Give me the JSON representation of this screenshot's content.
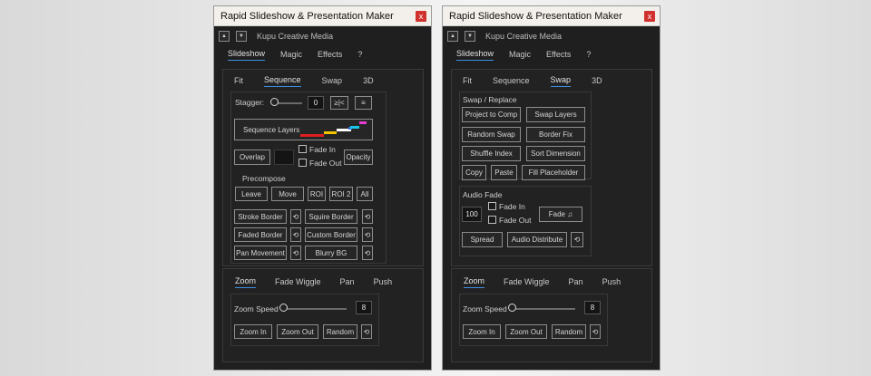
{
  "window_title": "Rapid Slideshow & Presentation Maker",
  "close_label": "x",
  "arrow_up": "▲",
  "arrow_down": "▼",
  "brand": "Kupu Creative Media",
  "main_tabs": [
    "Slideshow",
    "Magic",
    "Effects",
    "?"
  ],
  "sub_tabs": [
    "Fit",
    "Sequence",
    "Swap",
    "3D"
  ],
  "left": {
    "stagger_label": "Stagger:",
    "stagger_value": "0",
    "stagger_btn1": "≥|<",
    "stagger_btn2": "≡",
    "sequence_layers": "Sequence Layers",
    "overlap": "Overlap",
    "fade_in": "Fade In",
    "fade_out": "Fade Out",
    "opacity": "Opacity",
    "precompose": "Precompose",
    "precompose_buttons": [
      "Leave",
      "Move",
      "ROI",
      "ROI 2",
      "All"
    ],
    "stroke_border": "Stroke Border",
    "squire_border": "Squire Border",
    "faded_border": "Faded Border",
    "custom_border": "Custom Border",
    "pan_movement": "Pan Movement",
    "blurry_bg": "Blurry BG",
    "reset_icon": "⟲",
    "sequence_bar_colors": [
      "#e02020",
      "#f2c400",
      "#ffffff",
      "#2f6fe0",
      "#17c6e6",
      "#e63ad2"
    ]
  },
  "right": {
    "swap_replace": "Swap / Replace",
    "buttons": [
      "Project to Comp",
      "Swap Layers",
      "Random Swap",
      "Border Fix",
      "Shuffle Index",
      "Sort Dimension",
      "Copy",
      "Paste",
      "Fill Placeholder"
    ],
    "audio_fade": "Audio Fade",
    "audio_value": "100",
    "fade_in": "Fade In",
    "fade_out": "Fade Out",
    "fade_btn": "Fade ♫",
    "spread": "Spread",
    "audio_distribute": "Audio Distribute",
    "reset_icon": "⟲"
  },
  "bottom": {
    "tabs": [
      "Zoom",
      "Fade Wiggle",
      "Pan",
      "Push"
    ],
    "zoom_speed_label": "Zoom Speed",
    "zoom_speed_value": "8",
    "zoom_in": "Zoom In",
    "zoom_out": "Zoom Out",
    "random": "Random",
    "reset_icon": "⟲"
  }
}
